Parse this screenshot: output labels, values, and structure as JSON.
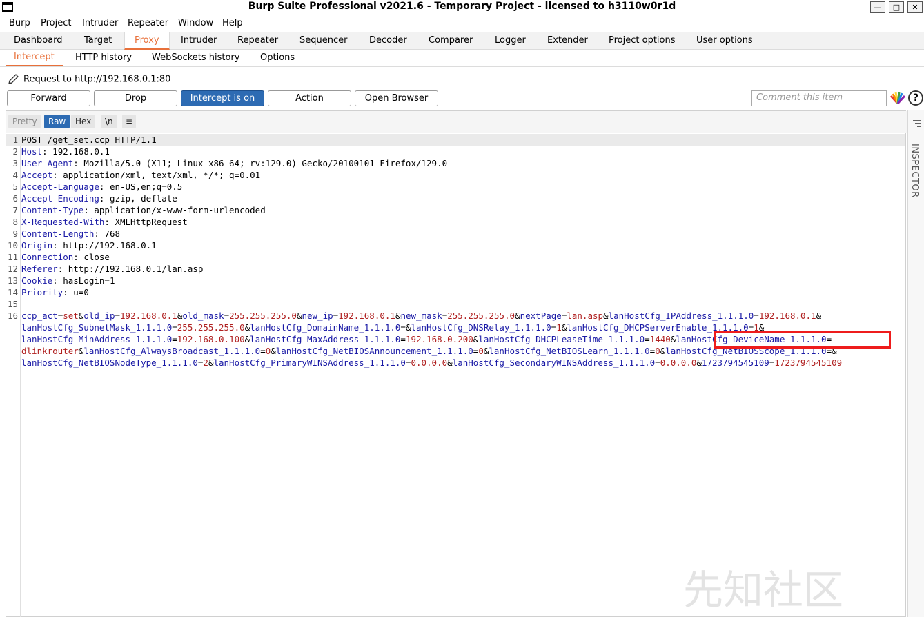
{
  "window": {
    "title": "Burp Suite Professional v2021.6 - Temporary Project - licensed to h3110w0r1d"
  },
  "menu": [
    "Burp",
    "Project",
    "Intruder",
    "Repeater",
    "Window",
    "Help"
  ],
  "main_tabs": [
    "Dashboard",
    "Target",
    "Proxy",
    "Intruder",
    "Repeater",
    "Sequencer",
    "Decoder",
    "Comparer",
    "Logger",
    "Extender",
    "Project options",
    "User options"
  ],
  "sub_tabs": [
    "Intercept",
    "HTTP history",
    "WebSockets history",
    "Options"
  ],
  "request_to": "Request to http://192.168.0.1:80",
  "buttons": {
    "forward": "Forward",
    "drop": "Drop",
    "intercept": "Intercept is on",
    "action": "Action",
    "open_browser": "Open Browser"
  },
  "comment_placeholder": "Comment this item",
  "view_tabs": {
    "pretty": "Pretty",
    "raw": "Raw",
    "hex": "Hex",
    "newline": "\\n"
  },
  "inspector_label": "INSPECTOR",
  "watermark": "先知社区",
  "headers": [
    {
      "n": "1",
      "key": "",
      "val": "POST /get_set.ccp HTTP/1.1"
    },
    {
      "n": "2",
      "key": "Host",
      "val": " 192.168.0.1"
    },
    {
      "n": "3",
      "key": "User-Agent",
      "val": " Mozilla/5.0 (X11; Linux x86_64; rv:129.0) Gecko/20100101 Firefox/129.0"
    },
    {
      "n": "4",
      "key": "Accept",
      "val": " application/xml, text/xml, */*; q=0.01"
    },
    {
      "n": "5",
      "key": "Accept-Language",
      "val": " en-US,en;q=0.5"
    },
    {
      "n": "6",
      "key": "Accept-Encoding",
      "val": " gzip, deflate"
    },
    {
      "n": "7",
      "key": "Content-Type",
      "val": " application/x-www-form-urlencoded"
    },
    {
      "n": "8",
      "key": "X-Requested-With",
      "val": " XMLHttpRequest"
    },
    {
      "n": "9",
      "key": "Content-Length",
      "val": " 768"
    },
    {
      "n": "10",
      "key": "Origin",
      "val": " http://192.168.0.1"
    },
    {
      "n": "11",
      "key": "Connection",
      "val": " close"
    },
    {
      "n": "12",
      "key": "Referer",
      "val": " http://192.168.0.1/lan.asp"
    },
    {
      "n": "13",
      "key": "Cookie",
      "val": " hasLogin=1"
    },
    {
      "n": "14",
      "key": "Priority",
      "val": " u=0"
    },
    {
      "n": "15",
      "key": "",
      "val": ""
    }
  ],
  "body_line_number": "16",
  "body_lines": [
    [
      [
        "ccp_act",
        "set"
      ],
      [
        "old_ip",
        "192.168.0.1"
      ],
      [
        "old_mask",
        "255.255.255.0"
      ],
      [
        "new_ip",
        "192.168.0.1"
      ],
      [
        "new_mask",
        "255.255.255.0"
      ],
      [
        "nextPage",
        "lan.asp"
      ],
      [
        "lanHostCfg_IPAddress_1.1.1.0",
        "192.168.0.1"
      ],
      [
        "",
        ""
      ]
    ],
    [
      [
        "lanHostCfg_SubnetMask_1.1.1.0",
        "255.255.255.0"
      ],
      [
        "lanHostCfg_DomainName_1.1.1.0",
        ""
      ],
      [
        "lanHostCfg_DNSRelay_1.1.1.0",
        "1"
      ],
      [
        "lanHostCfg_DHCPServerEnable_1.1.1.0",
        "1"
      ],
      [
        "",
        ""
      ]
    ],
    [
      [
        "lanHostCfg_MinAddress_1.1.1.0",
        "192.168.0.100"
      ],
      [
        "lanHostCfg_MaxAddress_1.1.1.0",
        "192.168.0.200"
      ],
      [
        "lanHostCfg_DHCPLeaseTime_1.1.1.0",
        "1440"
      ],
      [
        "lanHostCfg_DeviceName_1.1.1.0",
        ""
      ]
    ],
    [
      [
        "",
        "dlinkrouter"
      ],
      [
        "lanHostCfg_AlwaysBroadcast_1.1.1.0",
        "0"
      ],
      [
        "lanHostCfg_NetBIOSAnnouncement_1.1.1.0",
        "0"
      ],
      [
        "lanHostCfg_NetBIOSLearn_1.1.1.0",
        "0"
      ],
      [
        "lanHostCfg_NetBIOSScope_1.1.1.0",
        ""
      ],
      [
        "",
        ""
      ]
    ],
    [
      [
        "lanHostCfg_NetBIOSNodeType_1.1.1.0",
        "2"
      ],
      [
        "lanHostCfg_PrimaryWINSAddress_1.1.1.0",
        "0.0.0.0"
      ],
      [
        "lanHostCfg_SecondaryWINSAddress_1.1.1.0",
        "0.0.0.0"
      ],
      [
        "1723794545109",
        "1723794545109"
      ]
    ]
  ]
}
